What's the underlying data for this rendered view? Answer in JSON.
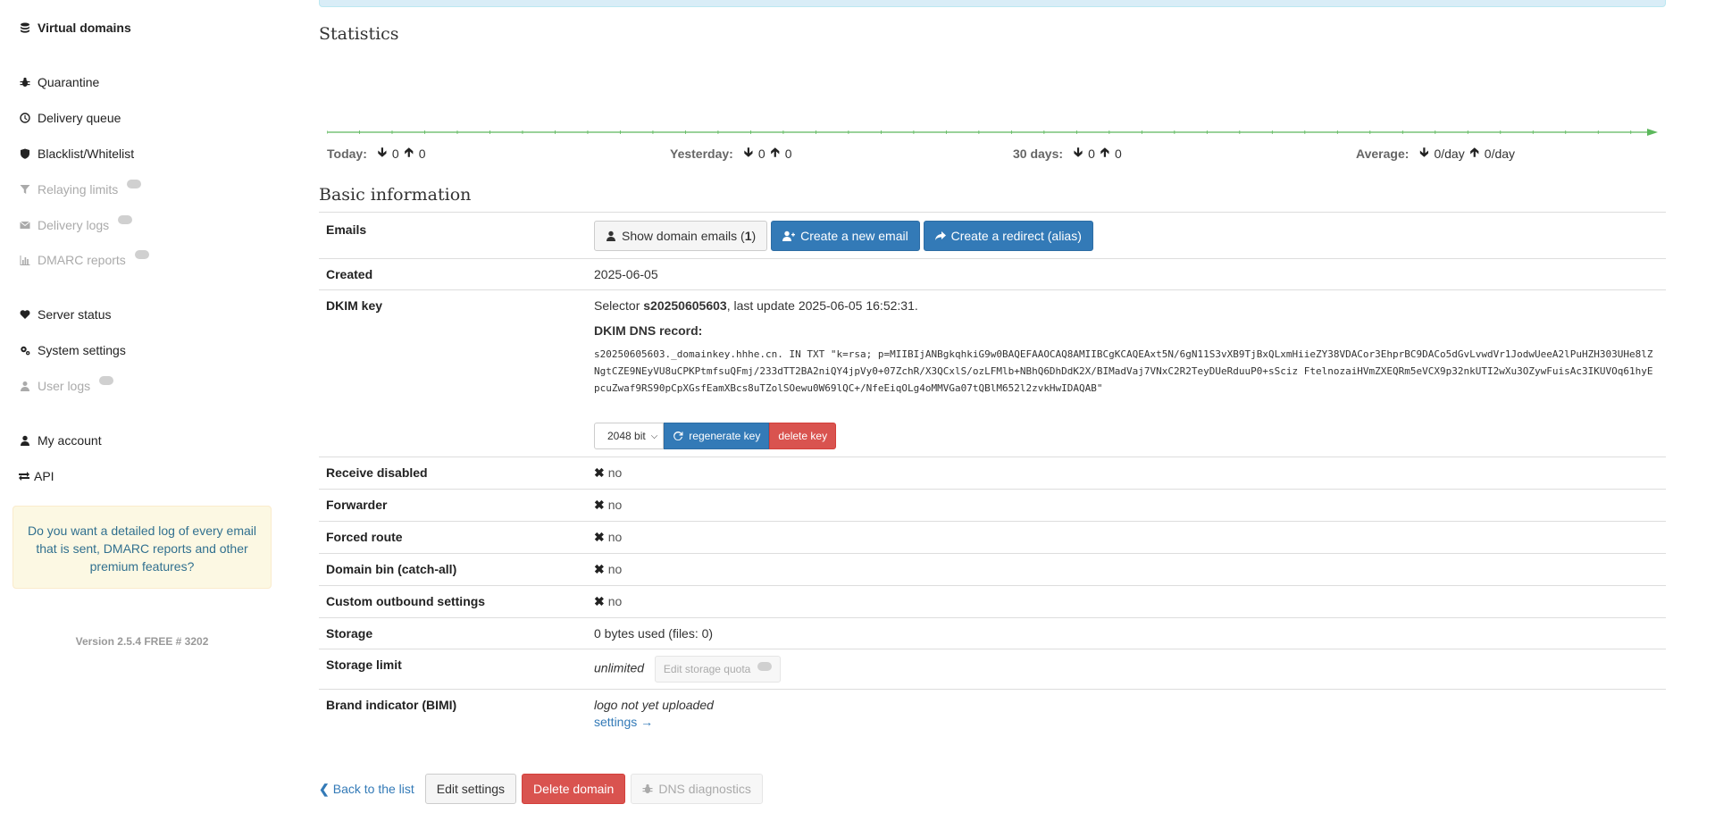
{
  "sidebar": {
    "items": [
      {
        "label": "Virtual domains",
        "icon": "database-icon"
      },
      {
        "label": "Quarantine",
        "icon": "bug-icon"
      },
      {
        "label": "Delivery queue",
        "icon": "clock-icon"
      },
      {
        "label": "Blacklist/Whitelist",
        "icon": "shield-icon"
      },
      {
        "label": "Relaying limits",
        "icon": "filter-icon"
      },
      {
        "label": "Delivery logs",
        "icon": "envelope-icon"
      },
      {
        "label": "DMARC reports",
        "icon": "bar-chart-icon"
      },
      {
        "label": "Server status",
        "icon": "heartbeat-icon"
      },
      {
        "label": "System settings",
        "icon": "cogs-icon"
      },
      {
        "label": "User logs",
        "icon": "user-secret-icon"
      },
      {
        "label": "My account",
        "icon": "user-icon"
      },
      {
        "label": "API",
        "icon": "exchange-icon"
      }
    ],
    "promo": "Do you want a detailed log of every email that is sent, DMARC reports and other premium features?",
    "version": "Version 2.5.4 FREE # 3202"
  },
  "statistics": {
    "title": "Statistics",
    "today_label": "Today:",
    "today_in": "0",
    "today_out": "0",
    "yesterday_label": "Yesterday:",
    "yesterday_in": "0",
    "yesterday_out": "0",
    "days30_label": "30 days:",
    "days30_in": "0",
    "days30_out": "0",
    "average_label": "Average:",
    "average_in": "0/day",
    "average_out": "0/day"
  },
  "chart_data": {
    "type": "line",
    "title": "",
    "series": [
      {
        "values": [
          0,
          0,
          0,
          0,
          0,
          0,
          0,
          0,
          0,
          0,
          0,
          0,
          0,
          0,
          0,
          0,
          0,
          0,
          0,
          0,
          0,
          0,
          0,
          0,
          0,
          0,
          0,
          0,
          0,
          0,
          0,
          0,
          0,
          0,
          0,
          0,
          0,
          0,
          0,
          0,
          0,
          0,
          0,
          0,
          0,
          0,
          0,
          0,
          0,
          0,
          0,
          0,
          0,
          0,
          0,
          0,
          0,
          0,
          0,
          0,
          0,
          0,
          0,
          0,
          0,
          0,
          0,
          0,
          0,
          0,
          0,
          0,
          0,
          0,
          0,
          0,
          0,
          0,
          0,
          0,
          0,
          0
        ]
      }
    ],
    "color": "#5cb85c"
  },
  "basic": {
    "title": "Basic information",
    "emails_label": "Emails",
    "show_emails_label": "Show domain emails (",
    "show_emails_count": "1",
    "show_emails_close": ")",
    "create_email_label": "Create a new email",
    "create_redirect_label": "Create a redirect (alias)",
    "created_label": "Created",
    "created_value": "2025-06-05",
    "dkim_label": "DKIM key",
    "selector_prefix": "Selector ",
    "selector_name": "s20250605603",
    "selector_suffix": ", last update 2025-06-05 16:52:31.",
    "dns_record_label": "DKIM DNS record:",
    "dns_record": "s20250605603._domainkey.hhhe.cn. IN TXT \"k=rsa; p=MIIBIjANBgkqhkiG9w0BAQEFAAOCAQ8AMIIBCgKCAQEAxt5N/6gN11S3vXB9TjBxQLxmHiieZY38VDACor3EhprBC9DACo5dGvLvwdVr1JodwUeeA2lPuHZH303UHe8lZNgtCZE9NEyVU8uCPKPtmfsuQFmj/233dTT2BA2niQY4jpVy0+07ZchR/X3QCxlS/ozLFMlb+NBhQ6DhDdK2X/BIMadVaj7VNxC2R2TeyDUeRduuP0+sSciz FtelnozaiHVmZXEQRm5eVCX9p32nkUTI2wXu3OZywFuisAc3IKUVOq61hyEpcuZwaf9RS90pCpXGsfEamXBcs8uTZolSOewu0W69lQC+/NfeEiqOLg4oMMVGa07tQBlM652l2zvkHwIDAQAB\"",
    "key_size": "2048 bit",
    "regenerate_label": "regenerate key",
    "delete_key_label": "delete key",
    "receive_disabled_label": "Receive disabled",
    "forwarder_label": "Forwarder",
    "forced_route_label": "Forced route",
    "domain_bin_label": "Domain bin (catch-all)",
    "custom_outbound_label": "Custom outbound settings",
    "no_text": "no",
    "storage_label": "Storage",
    "storage_value": "0 bytes used (files: 0)",
    "storage_limit_label": "Storage limit",
    "storage_limit_value": "unlimited",
    "edit_quota_label": "Edit storage quota",
    "bimi_label": "Brand indicator (BIMI)",
    "bimi_value": "logo not yet uploaded",
    "bimi_settings": "settings →"
  },
  "footer": {
    "back_label": "Back to the list",
    "edit_label": "Edit settings",
    "delete_label": "Delete domain",
    "dns_label": "DNS diagnostics"
  }
}
